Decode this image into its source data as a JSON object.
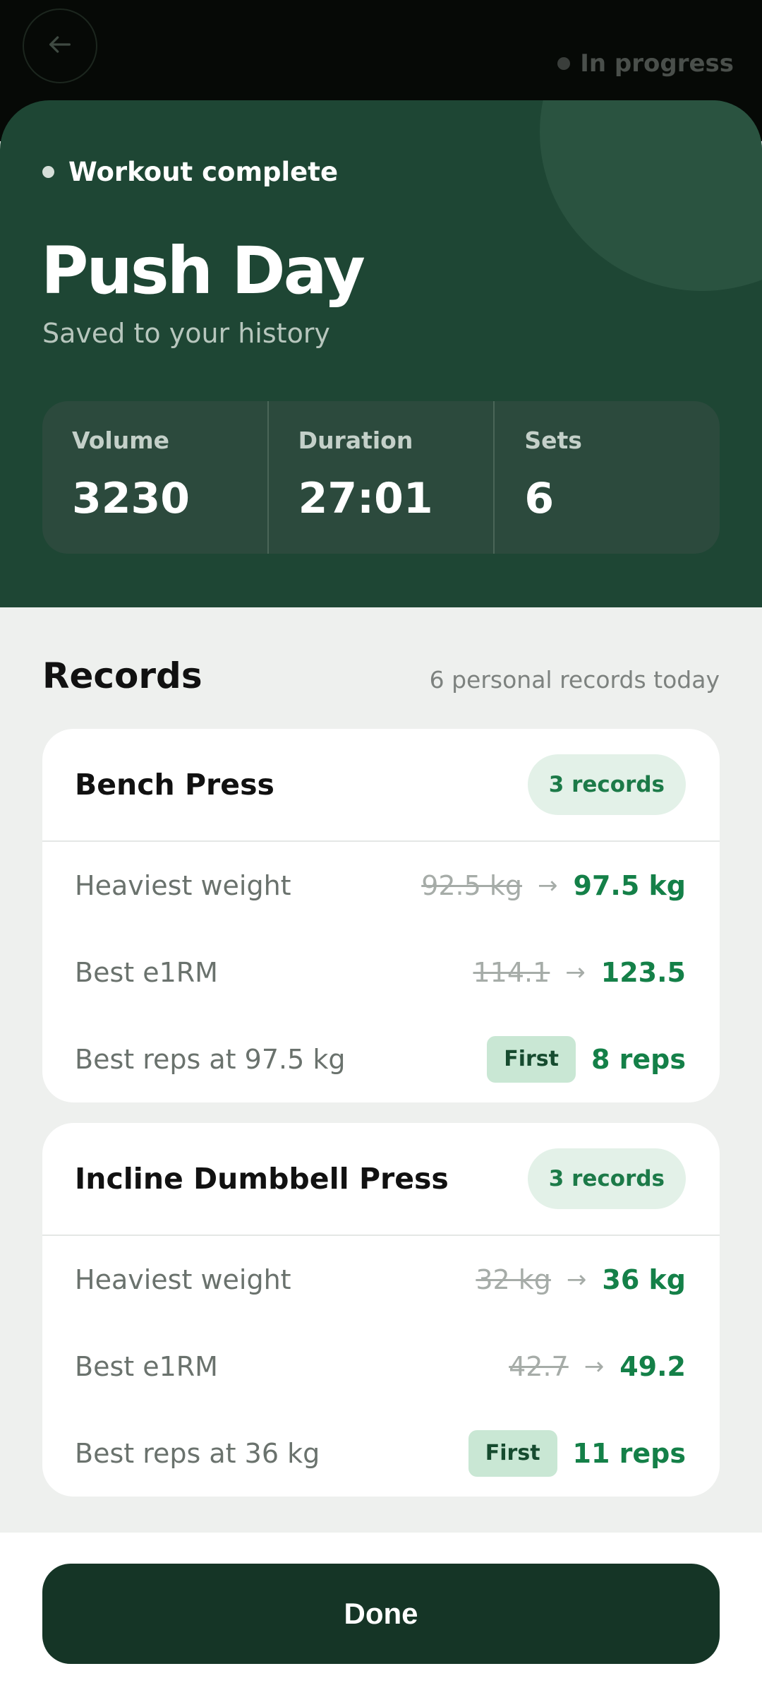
{
  "header": {
    "back_icon": "arrow-left-icon",
    "status": "In progress"
  },
  "hero": {
    "status_label": "Workout complete",
    "title": "Push Day",
    "subtitle": "Saved to your history",
    "stats": [
      {
        "label": "Volume",
        "value": "3230"
      },
      {
        "label": "Duration",
        "value": "27:01"
      },
      {
        "label": "Sets",
        "value": "6"
      }
    ]
  },
  "records": {
    "title": "Records",
    "summary": "6 personal records today",
    "cards": [
      {
        "exercise": "Bench Press",
        "badge": "3 records",
        "rows": [
          {
            "label": "Heaviest weight",
            "old": "92.5 kg",
            "new": "97.5 kg"
          },
          {
            "label": "Best e1RM",
            "old": "114.1",
            "new": "123.5"
          },
          {
            "label": "Best reps at 97.5 kg",
            "tag": "First",
            "new": "8 reps"
          }
        ]
      },
      {
        "exercise": "Incline Dumbbell Press",
        "badge": "3 records",
        "rows": [
          {
            "label": "Heaviest weight",
            "old": "32 kg",
            "new": "36 kg"
          },
          {
            "label": "Best e1RM",
            "old": "42.7",
            "new": "49.2"
          },
          {
            "label": "Best reps at 36 kg",
            "tag": "First",
            "new": "11 reps"
          }
        ]
      }
    ]
  },
  "footer": {
    "done_label": "Done"
  },
  "colors": {
    "hero_bg": "#1e4634",
    "accent_green": "#148048",
    "done_button": "#153526"
  }
}
